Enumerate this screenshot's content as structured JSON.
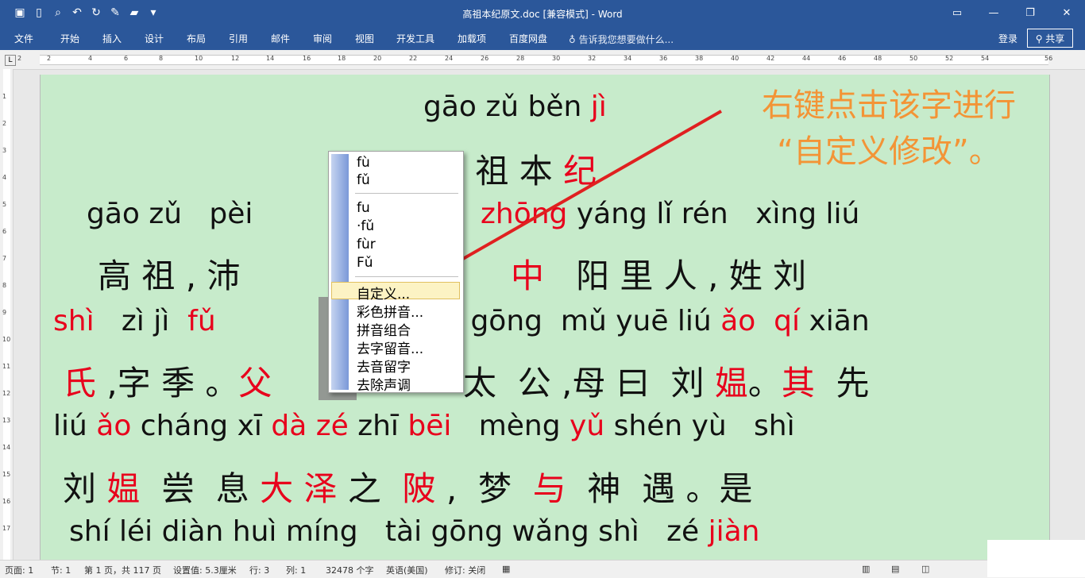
{
  "window": {
    "title": "高祖本纪原文.doc [兼容模式] - Word",
    "qat_icons": [
      "save-icon",
      "new-document-icon",
      "print-preview-icon",
      "undo-icon",
      "redo-icon",
      "edit-icon",
      "open-folder-icon",
      "customize-icon"
    ],
    "controls": [
      "ribbon-display-icon",
      "minimize-icon",
      "restore-icon",
      "close-icon"
    ]
  },
  "ribbon": {
    "tabs": [
      "文件",
      "开始",
      "插入",
      "设计",
      "布局",
      "引用",
      "邮件",
      "审阅",
      "视图",
      "开发工具",
      "加载项",
      "百度网盘"
    ],
    "tell_me": "告诉我您想要做什么...",
    "login": "登录",
    "share": "共享"
  },
  "ruler": {
    "h_numbers": [
      "2",
      "2",
      "4",
      "6",
      "8",
      "10",
      "12",
      "14",
      "16",
      "18",
      "20",
      "22",
      "24",
      "26",
      "28",
      "30",
      "32",
      "34",
      "36",
      "38",
      "40",
      "42",
      "44",
      "46",
      "48",
      "50",
      "52",
      "54",
      "56"
    ],
    "v_numbers": [
      "1",
      "2",
      "3",
      "4",
      "5",
      "6",
      "7",
      "8",
      "9",
      "10",
      "11",
      "12",
      "13",
      "14",
      "15",
      "16",
      "17"
    ]
  },
  "document": {
    "lines": [
      {
        "kind": "py",
        "segs": [
          {
            "t": "gāo zǔ běn ",
            "r": false
          },
          {
            "t": "jì",
            "r": true
          }
        ]
      },
      {
        "kind": "hz",
        "segs": [
          {
            "t": "高 祖 本 ",
            "r": false
          },
          {
            "t": "纪",
            "r": true
          }
        ]
      },
      {
        "kind": "py",
        "segs": [
          {
            "t": "gāo zǔ   pèi ",
            "r": false
          }
        ]
      },
      {
        "kind": "py",
        "segs": [
          {
            "t": "zhōng",
            "r": true
          },
          {
            "t": " yáng lǐ rén   xìng liú",
            "r": false
          }
        ]
      },
      {
        "kind": "hz",
        "segs": [
          {
            "t": "高 祖 , 沛",
            "r": false
          }
        ]
      },
      {
        "kind": "hz",
        "segs": [
          {
            "t": "中",
            "r": true
          },
          {
            "t": "   阳 里 人 , 姓 刘",
            "r": false
          }
        ]
      },
      {
        "kind": "py",
        "segs": [
          {
            "t": "shì",
            "r": true
          },
          {
            "t": "   zì jì  ",
            "r": false
          },
          {
            "t": "fǔ",
            "r": true
          }
        ]
      },
      {
        "kind": "py",
        "segs": [
          {
            "t": "i gōng  mǔ yuē liú ",
            "r": false
          },
          {
            "t": "ǎo",
            "r": true
          },
          {
            "t": "  ",
            "r": false
          },
          {
            "t": "qí",
            "r": true
          },
          {
            "t": " xiān",
            "r": false
          }
        ]
      },
      {
        "kind": "hz",
        "segs": [
          {
            "t": "氏",
            "r": true
          },
          {
            "t": " ,字 季 。",
            "r": false
          },
          {
            "t": "父",
            "r": true
          }
        ]
      },
      {
        "kind": "hz",
        "segs": [
          {
            "t": "太  公 ,母 曰  刘 ",
            "r": false
          },
          {
            "t": "媪",
            "r": true
          },
          {
            "t": "。",
            "r": false
          },
          {
            "t": "其",
            "r": true
          },
          {
            "t": "  先",
            "r": false
          }
        ]
      },
      {
        "kind": "py",
        "segs": [
          {
            "t": "liú ",
            "r": false
          },
          {
            "t": "ǎo",
            "r": true
          },
          {
            "t": " cháng xī ",
            "r": false
          },
          {
            "t": "dà zé",
            "r": true
          },
          {
            "t": " zhī ",
            "r": false
          },
          {
            "t": "bēi",
            "r": true
          },
          {
            "t": "   mèng ",
            "r": false
          },
          {
            "t": "yǔ",
            "r": true
          },
          {
            "t": " shén yù   shì",
            "r": false
          }
        ]
      },
      {
        "kind": "hz",
        "segs": [
          {
            "t": "刘 ",
            "r": false
          },
          {
            "t": "媪",
            "r": true
          },
          {
            "t": "  尝  息 ",
            "r": false
          },
          {
            "t": "大 泽",
            "r": true
          },
          {
            "t": " 之  ",
            "r": false
          },
          {
            "t": "陂",
            "r": true
          },
          {
            "t": " ,  梦  ",
            "r": false
          },
          {
            "t": "与",
            "r": true
          },
          {
            "t": "  神  遇 。是",
            "r": false
          }
        ]
      },
      {
        "kind": "py",
        "segs": [
          {
            "t": "shí léi diàn huì míng   tài gōng wǎng shì   zé ",
            "r": false
          },
          {
            "t": "jiàn",
            "r": true
          }
        ]
      }
    ]
  },
  "annotation": {
    "line1": "右键点击该字进行",
    "line2": "“自定义修改”。",
    "color": "#f39436"
  },
  "context_menu": {
    "group1": [
      "fù",
      "fǔ"
    ],
    "group2": [
      "fu",
      "·fǔ",
      "fùr",
      "Fǔ"
    ],
    "group3": [
      "自定义...",
      "彩色拼音...",
      "拼音组合",
      "去字留音...",
      "去音留字",
      "去除声调"
    ]
  },
  "status": {
    "page": "页面: 1",
    "section": "节: 1",
    "page_of": "第 1 页，共 117 页",
    "setting": "设置值: 5.3厘米",
    "row": "行: 3",
    "col": "列: 1",
    "words": "32478 个字",
    "lang": "英语(美国)",
    "track": "修订: 关闭"
  }
}
